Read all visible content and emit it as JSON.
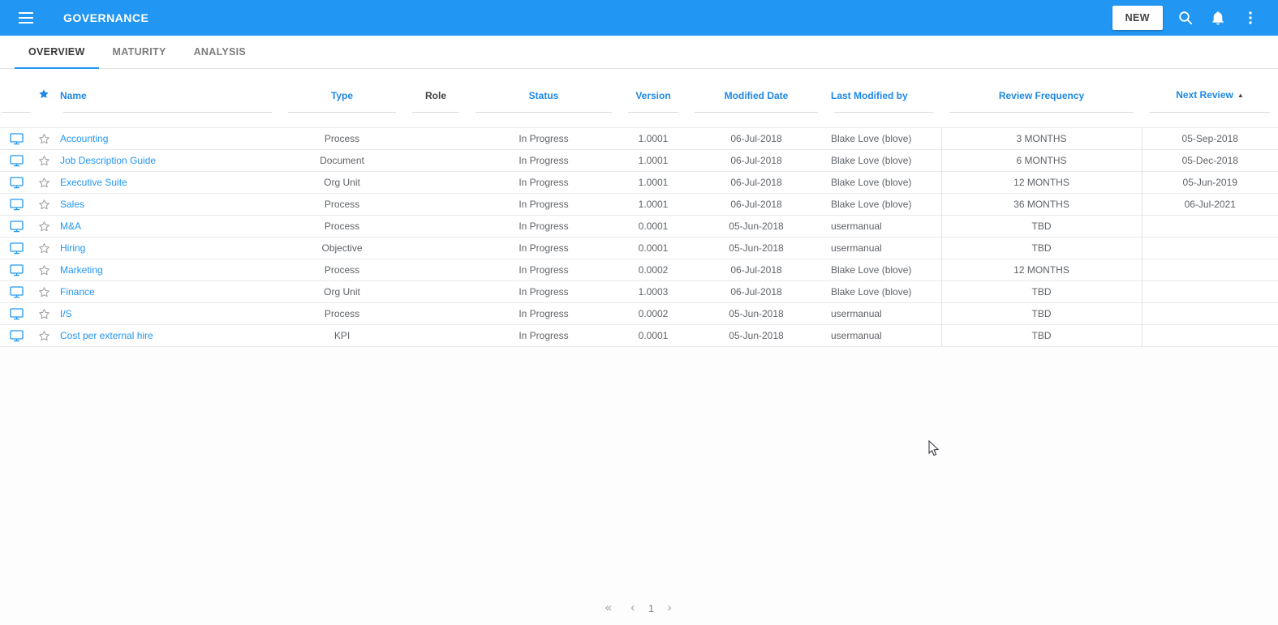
{
  "colors": {
    "accent": "#2196f3",
    "column_header": "#1e88e5",
    "link": "#2196f3"
  },
  "app_bar": {
    "title": "GOVERNANCE",
    "new_button_label": "NEW",
    "icons": [
      "hamburger-menu-icon",
      "search-icon",
      "notifications-bell-icon",
      "kebab-menu-icon"
    ]
  },
  "tabs": [
    {
      "label": "OVERVIEW",
      "active": true
    },
    {
      "label": "MATURITY",
      "active": false
    },
    {
      "label": "ANALYSIS",
      "active": false
    }
  ],
  "table": {
    "columns": [
      {
        "key": "icon",
        "label": "",
        "align": "center",
        "header_icon": ""
      },
      {
        "key": "fav",
        "label": "",
        "align": "center",
        "header_icon": "star-filled-icon"
      },
      {
        "key": "name",
        "label": "Name",
        "align": "left"
      },
      {
        "key": "type",
        "label": "Type",
        "align": "center"
      },
      {
        "key": "role",
        "label": "Role",
        "align": "center",
        "muted": true
      },
      {
        "key": "status",
        "label": "Status",
        "align": "center"
      },
      {
        "key": "version",
        "label": "Version",
        "align": "center"
      },
      {
        "key": "modified_date",
        "label": "Modified Date",
        "align": "center"
      },
      {
        "key": "last_modified_by",
        "label": "Last Modified by",
        "align": "left"
      },
      {
        "key": "review_frequency",
        "label": "Review Frequency",
        "align": "center",
        "bordered": true
      },
      {
        "key": "next_review",
        "label": "Next Review",
        "align": "center",
        "sort": "asc"
      }
    ],
    "row_icons": {
      "open": "monitor-display-icon",
      "favorite": "star-outline-icon"
    },
    "rows": [
      {
        "name": "Accounting",
        "type": "Process",
        "role": "",
        "status": "In Progress",
        "version": "1.0001",
        "modified_date": "06-Jul-2018",
        "last_modified_by": "Blake Love (blove)",
        "review_frequency": "3 MONTHS",
        "next_review": "05-Sep-2018"
      },
      {
        "name": "Job Description Guide",
        "type": "Document",
        "role": "",
        "status": "In Progress",
        "version": "1.0001",
        "modified_date": "06-Jul-2018",
        "last_modified_by": "Blake Love (blove)",
        "review_frequency": "6 MONTHS",
        "next_review": "05-Dec-2018"
      },
      {
        "name": "Executive Suite",
        "type": "Org Unit",
        "role": "",
        "status": "In Progress",
        "version": "1.0001",
        "modified_date": "06-Jul-2018",
        "last_modified_by": "Blake Love (blove)",
        "review_frequency": "12 MONTHS",
        "next_review": "05-Jun-2019"
      },
      {
        "name": "Sales",
        "type": "Process",
        "role": "",
        "status": "In Progress",
        "version": "1.0001",
        "modified_date": "06-Jul-2018",
        "last_modified_by": "Blake Love (blove)",
        "review_frequency": "36 MONTHS",
        "next_review": "06-Jul-2021"
      },
      {
        "name": "M&A",
        "type": "Process",
        "role": "",
        "status": "In Progress",
        "version": "0.0001",
        "modified_date": "05-Jun-2018",
        "last_modified_by": "usermanual",
        "review_frequency": "TBD",
        "next_review": ""
      },
      {
        "name": "Hiring",
        "type": "Objective",
        "role": "",
        "status": "In Progress",
        "version": "0.0001",
        "modified_date": "05-Jun-2018",
        "last_modified_by": "usermanual",
        "review_frequency": "TBD",
        "next_review": ""
      },
      {
        "name": "Marketing",
        "type": "Process",
        "role": "",
        "status": "In Progress",
        "version": "0.0002",
        "modified_date": "06-Jul-2018",
        "last_modified_by": "Blake Love (blove)",
        "review_frequency": "12 MONTHS",
        "next_review": ""
      },
      {
        "name": "Finance",
        "type": "Org Unit",
        "role": "",
        "status": "In Progress",
        "version": "1.0003",
        "modified_date": "06-Jul-2018",
        "last_modified_by": "Blake Love (blove)",
        "review_frequency": "TBD",
        "next_review": ""
      },
      {
        "name": "I/S",
        "type": "Process",
        "role": "",
        "status": "In Progress",
        "version": "0.0002",
        "modified_date": "05-Jun-2018",
        "last_modified_by": "usermanual",
        "review_frequency": "TBD",
        "next_review": ""
      },
      {
        "name": "Cost per external hire",
        "type": "KPI",
        "role": "",
        "status": "In Progress",
        "version": "0.0001",
        "modified_date": "05-Jun-2018",
        "last_modified_by": "usermanual",
        "review_frequency": "TBD",
        "next_review": ""
      }
    ]
  },
  "pagination": {
    "first": "«",
    "previous": "‹",
    "current_page": "1",
    "next": "›"
  }
}
